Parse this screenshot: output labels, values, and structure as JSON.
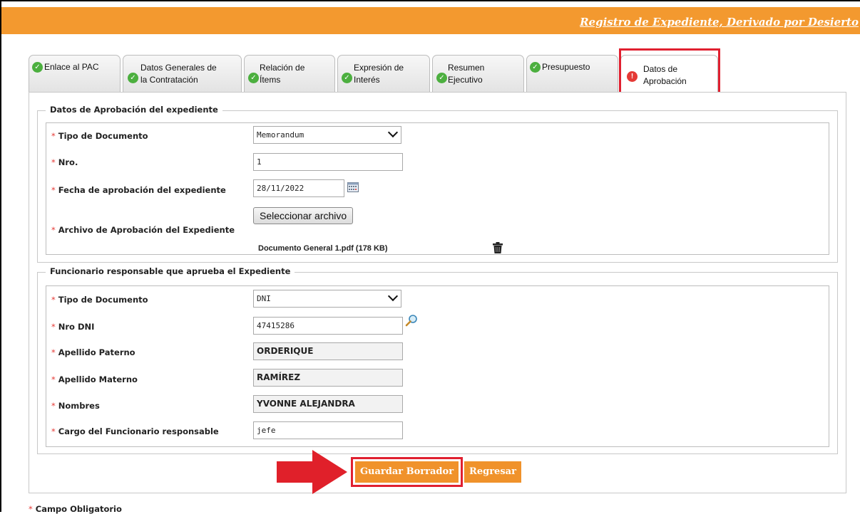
{
  "header": {
    "title": "Registro de Expediente, Derivado por Desierto"
  },
  "tabs": [
    {
      "line1": "Enlace al PAC",
      "line2": "",
      "status": "complete"
    },
    {
      "line1": "Datos Generales de",
      "line2": "la Contratación",
      "status": "complete"
    },
    {
      "line1": "Relación de",
      "line2": "Ítems",
      "status": "complete"
    },
    {
      "line1": "Expresión de",
      "line2": "Interés",
      "status": "complete"
    },
    {
      "line1": "Resumen",
      "line2": "Ejecutivo",
      "status": "complete"
    },
    {
      "line1": "Presupuesto",
      "line2": "",
      "status": "complete"
    },
    {
      "line1": "Datos de",
      "line2": "Aprobación",
      "status": "warning"
    }
  ],
  "aprobacion": {
    "legend": "Datos de Aprobación del expediente",
    "tipo_label": "Tipo de Documento",
    "tipo_value": "Memorandum",
    "nro_label": "Nro.",
    "nro_value": "1",
    "fecha_label": "Fecha de aprobación del expediente",
    "fecha_value": "28/11/2022",
    "archivo_label": "Archivo de Aprobación del Expediente",
    "archivo_button": "Seleccionar archivo",
    "archivo_file": "Documento General 1.pdf (178 KB)"
  },
  "funcionario": {
    "legend": "Funcionario responsable que aprueba el Expediente",
    "tipo_label": "Tipo de Documento",
    "tipo_value": "DNI",
    "dni_label": "Nro DNI",
    "dni_value": "47415286",
    "paterno_label": "Apellido Paterno",
    "paterno_value": "ORDERIQUE",
    "materno_label": "Apellido Materno",
    "materno_value": "RAMÍREZ",
    "nombres_label": "Nombres",
    "nombres_value": "YVONNE ALEJANDRA",
    "cargo_label": "Cargo del Funcionario responsable",
    "cargo_value": "jefe"
  },
  "actions": {
    "guardar": "Guardar Borrador",
    "regresar": "Regresar"
  },
  "required_mark": "*",
  "footer": {
    "note": "Campo Obligatorio"
  },
  "colors": {
    "accent": "#f3992f",
    "highlight": "#e02030",
    "ok": "#4caf3f",
    "warn": "#e53935"
  }
}
